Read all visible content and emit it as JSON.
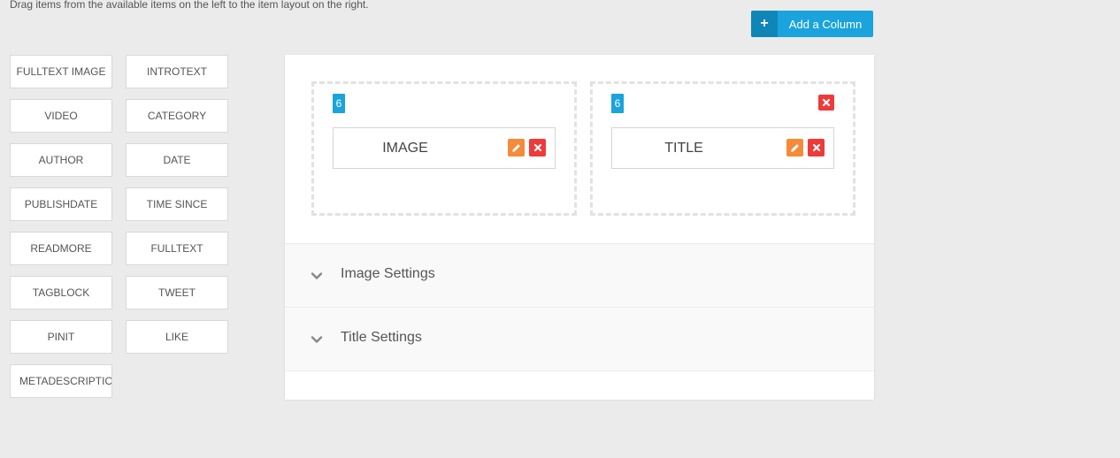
{
  "hint": "Drag items from the available items on the left to the item layout on the right.",
  "add_column": {
    "icon": "+",
    "label": "Add a Column"
  },
  "palette": [
    "FULLTEXT IMAGE",
    "INTROTEXT",
    "VIDEO",
    "CATEGORY",
    "AUTHOR",
    "DATE",
    "PUBLISHDATE",
    "TIME SINCE",
    "READMORE",
    "FULLTEXT",
    "TAGBLOCK",
    "TWEET",
    "PINIT",
    "LIKE",
    "METADESCRIPTION"
  ],
  "columns": [
    {
      "width": "6",
      "item": "IMAGE",
      "removable": false
    },
    {
      "width": "6",
      "item": "TITLE",
      "removable": true
    }
  ],
  "icons": {
    "edit": "pencil-icon",
    "delete": "close-icon",
    "chevron": "chevron-down-icon"
  },
  "settings": [
    {
      "title": "Image Settings"
    },
    {
      "title": "Title Settings"
    }
  ],
  "colors": {
    "accent": "#1aa3dd",
    "accent_dark": "#0f86b8",
    "edit": "#f58a3a",
    "delete": "#ef3a3a",
    "background": "#ebebeb"
  }
}
